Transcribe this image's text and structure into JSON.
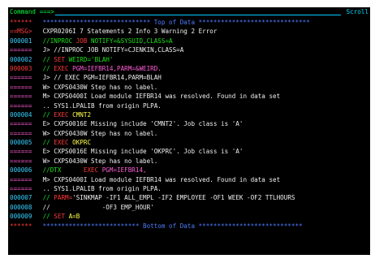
{
  "command_bar": {
    "label": "Command ===>",
    "value": "",
    "scroll_label": "Scroll"
  },
  "lines": [
    {
      "prefix": "******",
      "pc": "c-red",
      "segments": [
        {
          "t": " ***************************** Top of Data ******************************",
          "c": "c-blue"
        }
      ]
    },
    {
      "prefix": "==MSG>",
      "pc": "c-red",
      "segments": [
        {
          "t": " CXPR0206I 7 Statements 2 Info 3 Warning 2 Error",
          "c": "c-white"
        }
      ]
    },
    {
      "prefix": "000001",
      "pc": "c-cyan",
      "segments": [
        {
          "t": " //INPROC ",
          "c": "c-green"
        },
        {
          "t": "JOB ",
          "c": "c-red"
        },
        {
          "t": "NOTIFY=&SYSUID,CLASS=A",
          "c": "c-green"
        }
      ]
    },
    {
      "prefix": "======",
      "pc": "c-pink",
      "segments": [
        {
          "t": " J> //INPROC JOB NOTIFY=CJENKIN,CLASS=A",
          "c": "c-white"
        }
      ]
    },
    {
      "prefix": "000002",
      "pc": "c-cyan",
      "segments": [
        {
          "t": " // ",
          "c": "c-green"
        },
        {
          "t": "SET ",
          "c": "c-red"
        },
        {
          "t": "WEIRD='BLAH'",
          "c": "c-green"
        }
      ]
    },
    {
      "prefix": "000003",
      "pc": "c-red",
      "segments": [
        {
          "t": " // ",
          "c": "c-green"
        },
        {
          "t": "EXEC ",
          "c": "c-red"
        },
        {
          "t": "PGM=IEFBR14,PARM=&WEIRD.",
          "c": "c-pink"
        }
      ]
    },
    {
      "prefix": "======",
      "pc": "c-pink",
      "segments": [
        {
          "t": " J> // EXEC PGM=IEFBR14,PARM=BLAH",
          "c": "c-white"
        }
      ]
    },
    {
      "prefix": "======",
      "pc": "c-pink",
      "segments": [
        {
          "t": " W> CXPS0430W Step has no label.",
          "c": "c-white"
        }
      ]
    },
    {
      "prefix": "======",
      "pc": "c-pink",
      "segments": [
        {
          "t": " M> CXPS0400I Load module IEFBR14 was resolved. Found in data set",
          "c": "c-white"
        }
      ]
    },
    {
      "prefix": "======",
      "pc": "c-pink",
      "segments": [
        {
          "t": " .. SYS1.LPALIB from origin PLPA.",
          "c": "c-white"
        }
      ]
    },
    {
      "prefix": "000004",
      "pc": "c-cyan",
      "segments": [
        {
          "t": " // ",
          "c": "c-green"
        },
        {
          "t": "EXEC ",
          "c": "c-red"
        },
        {
          "t": "CMNT2",
          "c": "c-yellow"
        }
      ]
    },
    {
      "prefix": "======",
      "pc": "c-pink",
      "segments": [
        {
          "t": " E> CXPS0016E Missing include 'CMNT2'. Job class is 'A'",
          "c": "c-white"
        }
      ]
    },
    {
      "prefix": "======",
      "pc": "c-pink",
      "segments": [
        {
          "t": " W> CXPS0430W Step has no label.",
          "c": "c-white"
        }
      ]
    },
    {
      "prefix": "000005",
      "pc": "c-cyan",
      "segments": [
        {
          "t": " // ",
          "c": "c-green"
        },
        {
          "t": "EXEC ",
          "c": "c-red"
        },
        {
          "t": "OKPRC",
          "c": "c-yellow"
        }
      ]
    },
    {
      "prefix": "======",
      "pc": "c-pink",
      "segments": [
        {
          "t": " E> CXPS0016E Missing include 'OKPRC'. Job class is 'A'",
          "c": "c-white"
        }
      ]
    },
    {
      "prefix": "======",
      "pc": "c-pink",
      "segments": [
        {
          "t": " W> CXPS0430W Step has no label.",
          "c": "c-white"
        }
      ]
    },
    {
      "prefix": "000006",
      "pc": "c-cyan",
      "segments": [
        {
          "t": " //DTX      ",
          "c": "c-green"
        },
        {
          "t": "EXEC ",
          "c": "c-red"
        },
        {
          "t": "PGM=IEFBR14,",
          "c": "c-pink"
        }
      ]
    },
    {
      "prefix": "======",
      "pc": "c-pink",
      "segments": [
        {
          "t": " M> CXPS0400I Load module IEFBR14 was resolved. Found in data set",
          "c": "c-white"
        }
      ]
    },
    {
      "prefix": "======",
      "pc": "c-pink",
      "segments": [
        {
          "t": " .. SYS1.LPALIB from origin PLPA.",
          "c": "c-white"
        }
      ]
    },
    {
      "prefix": "000007",
      "pc": "c-cyan",
      "segments": [
        {
          "t": " // ",
          "c": "c-green"
        },
        {
          "t": "PARM=",
          "c": "c-red"
        },
        {
          "t": "'SINKMAP -IF1 ALL_EMPL -IF2 EMPLOYEE -OF1 WEEK -OF2 TTLHOURS",
          "c": "c-white"
        }
      ]
    },
    {
      "prefix": "000008",
      "pc": "c-cyan",
      "segments": [
        {
          "t": " //              -OF3 EMP_HOUR'",
          "c": "c-white"
        }
      ]
    },
    {
      "prefix": "000009",
      "pc": "c-cyan",
      "segments": [
        {
          "t": " // ",
          "c": "c-green"
        },
        {
          "t": "SET ",
          "c": "c-red"
        },
        {
          "t": "A=B",
          "c": "c-yellow"
        }
      ]
    },
    {
      "prefix": "******",
      "pc": "c-red",
      "segments": [
        {
          "t": " ************************** Bottom of Data ****************************",
          "c": "c-blue"
        }
      ]
    }
  ]
}
